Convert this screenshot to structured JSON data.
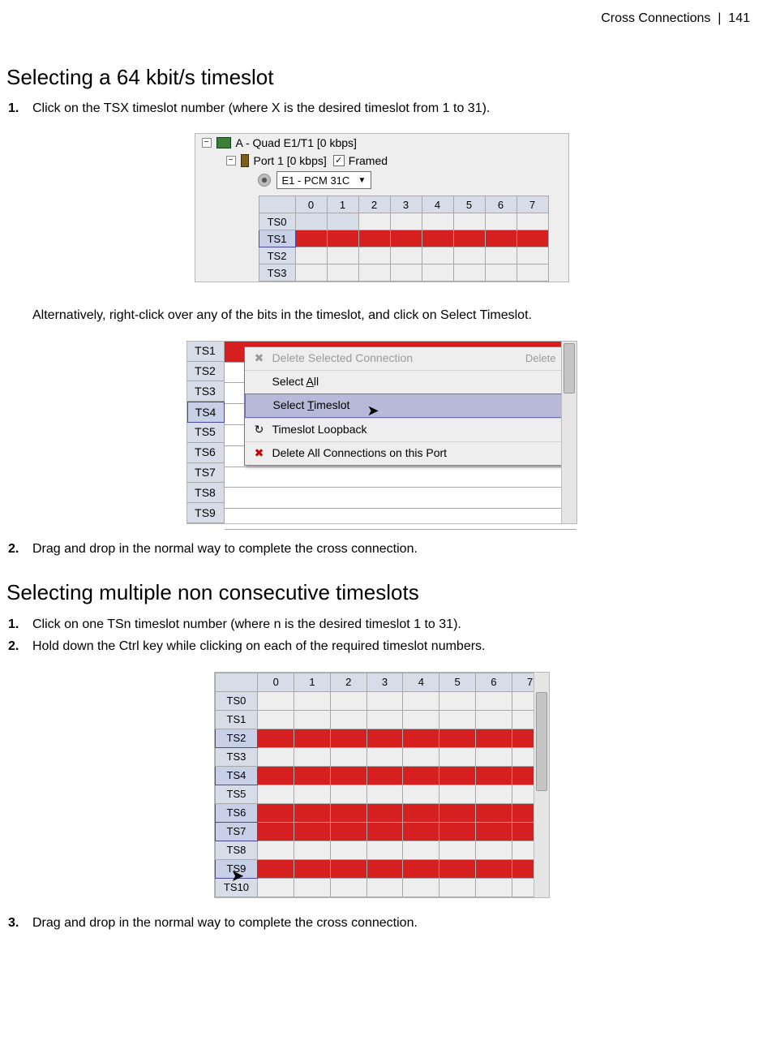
{
  "header": {
    "section": "Cross Connections",
    "sep": "|",
    "page": "141"
  },
  "section1": {
    "heading": "Selecting a 64 kbit/s timeslot",
    "steps": {
      "s1": {
        "n": "1.",
        "t": "Click on the TSX timeslot number (where X is the desired timeslot from 1 to 31)."
      },
      "alt": "Alternatively, right-click over any of the bits in the timeslot, and click on Select Timeslot.",
      "s2": {
        "n": "2.",
        "t": "Drag and drop in the normal way to complete the cross connection."
      }
    }
  },
  "section2": {
    "heading": "Selecting multiple non consecutive timeslots",
    "steps": {
      "s1": {
        "n": "1.",
        "t": "Click on one TSn timeslot number (where n is the desired timeslot 1 to 31)."
      },
      "s2": {
        "n": "2.",
        "t": "Hold down the Ctrl key while clicking on each of the required timeslot numbers."
      },
      "s3": {
        "n": "3.",
        "t": "Drag and drop in the normal way to complete the cross connection."
      }
    }
  },
  "fig1": {
    "tree": {
      "card": "A - Quad E1/T1 [0 kbps]",
      "port": "Port 1 [0 kbps]",
      "framed_label": "Framed",
      "framed_checked": true,
      "combo": "E1 - PCM 31C"
    },
    "cols": [
      "0",
      "1",
      "2",
      "3",
      "4",
      "5",
      "6",
      "7"
    ],
    "rows": [
      "TS0",
      "TS1",
      "TS2",
      "TS3"
    ],
    "selected_row": "TS1",
    "ts0_blocked_cols": [
      0,
      1
    ]
  },
  "fig2": {
    "rows": [
      "TS1",
      "TS2",
      "TS3",
      "TS4",
      "TS5",
      "TS6",
      "TS7",
      "TS8",
      "TS9"
    ],
    "red_rows": [
      "TS1"
    ],
    "selected_row": "TS4",
    "menu": {
      "delete_sel": {
        "label": "Delete Selected Connection",
        "shortcut": "Delete",
        "disabled": true
      },
      "select_all": {
        "label_pre": "Select ",
        "label_u": "A",
        "label_post": "ll"
      },
      "select_ts": {
        "label_pre": "Select ",
        "label_u": "T",
        "label_post": "imeslot"
      },
      "ts_loopback": {
        "label": "Timeslot Loopback"
      },
      "delete_port": {
        "label": "Delete All Connections on this Port"
      }
    }
  },
  "fig3": {
    "cols": [
      "0",
      "1",
      "2",
      "3",
      "4",
      "5",
      "6",
      "7"
    ],
    "rows": [
      "TS0",
      "TS1",
      "TS2",
      "TS3",
      "TS4",
      "TS5",
      "TS6",
      "TS7",
      "TS8",
      "TS9",
      "TS10"
    ],
    "selected_rows": [
      "TS2",
      "TS4",
      "TS6",
      "TS7",
      "TS9"
    ]
  }
}
